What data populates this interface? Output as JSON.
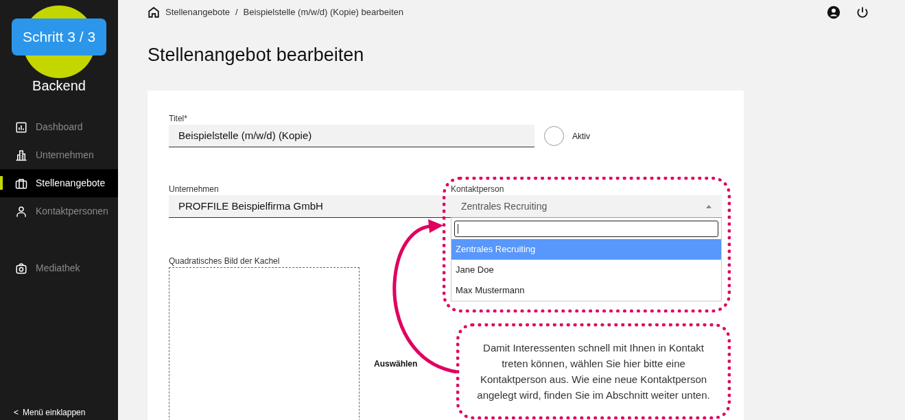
{
  "sidebar": {
    "step_badge": "Schritt 3 / 3",
    "title": "Backend",
    "nav_items": [
      {
        "label": "Dashboard",
        "selected": false
      },
      {
        "label": "Unternehmen",
        "selected": false
      },
      {
        "label": "Stellenangebote",
        "selected": true
      },
      {
        "label": "Kontaktpersonen",
        "selected": false
      }
    ],
    "media_items": [
      {
        "label": "Mediathek",
        "selected": false
      }
    ],
    "collapse": {
      "icon": "<",
      "label": "Menü einklappen"
    }
  },
  "breadcrumb": [
    "Stellenangebote",
    "Beispielstelle (m/w/d) (Kopie) bearbeiten"
  ],
  "breadcrumb_separator": "/",
  "page_title": "Stellenangebot bearbeiten",
  "form": {
    "title": {
      "label": "Titel*",
      "value": "Beispielstelle (m/w/d) (Kopie)"
    },
    "active": {
      "label": "Aktiv",
      "checked": false
    },
    "company": {
      "label": "Unternehmen",
      "value": "PROFFILE Beispielfirma GmbH"
    },
    "contact": {
      "label": "Kontaktperson",
      "value": "Zentrales Recruiting",
      "expanded": true,
      "options": [
        {
          "label": "Zentrales Recruiting",
          "selected": true
        },
        {
          "label": "Jane Doe",
          "selected": false
        },
        {
          "label": "Max Mustermann",
          "selected": false
        }
      ]
    },
    "image": {
      "label": "Quadratisches Bild der Kachel",
      "button": "Auswählen"
    }
  },
  "annotation": {
    "text": "Damit Interessenten schnell mit Ihnen in Kontakt treten können, wählen Sie hier bitte eine Kontaktperson aus. Wie eine neue Kontaktperson angelegt wird, finden Sie im Abschnitt weiter unten."
  }
}
